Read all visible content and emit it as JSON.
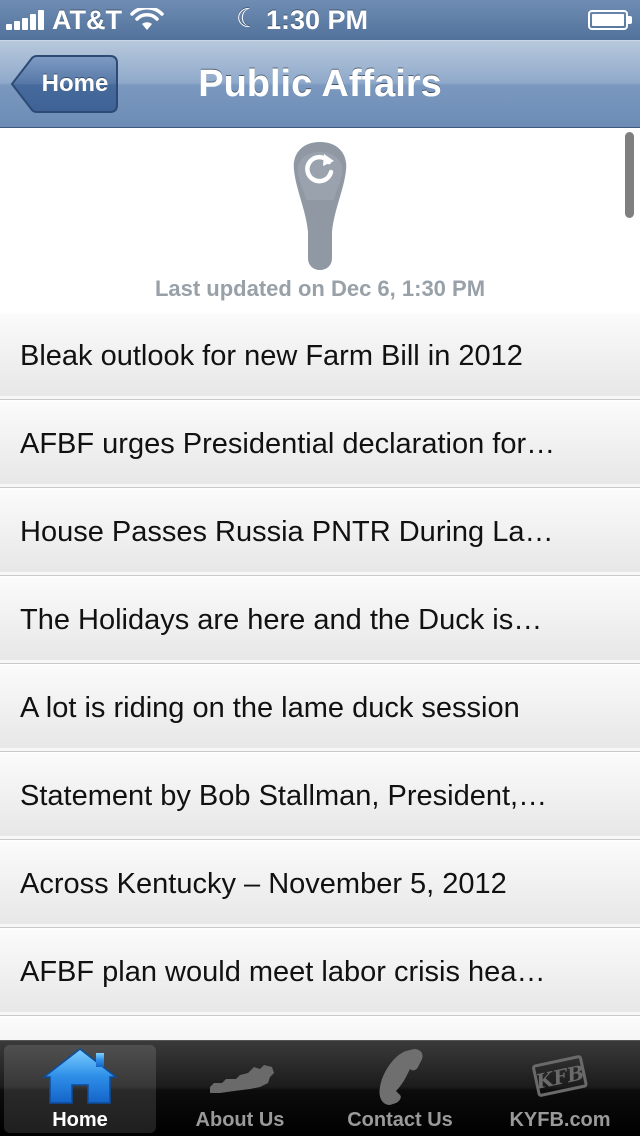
{
  "status_bar": {
    "carrier": "AT&T",
    "time": "1:30 PM",
    "battery_level": 1.0,
    "icons": [
      "signal-icon",
      "wifi-icon",
      "moon-icon",
      "battery-icon"
    ]
  },
  "nav_bar": {
    "back_label": "Home",
    "title": "Public Affairs"
  },
  "refresh": {
    "last_updated": "Last updated on Dec 6, 1:30 PM",
    "icon": "refresh-icon"
  },
  "articles": [
    {
      "title": "Bleak outlook for new Farm Bill in 2012"
    },
    {
      "title": "AFBF urges Presidential declaration for…"
    },
    {
      "title": "House Passes Russia PNTR During La…"
    },
    {
      "title": "The Holidays are here and the Duck is…"
    },
    {
      "title": "A lot is riding on the lame duck session"
    },
    {
      "title": "Statement by Bob Stallman, President,…"
    },
    {
      "title": "Across Kentucky – November 5, 2012"
    },
    {
      "title": "AFBF plan would meet labor crisis hea…"
    },
    {
      "title": ""
    }
  ],
  "tab_bar": {
    "tabs": [
      {
        "label": "Home",
        "icon": "house-icon",
        "selected": true
      },
      {
        "label": "About Us",
        "icon": "kentucky-map-icon",
        "selected": false
      },
      {
        "label": "Contact Us",
        "icon": "phone-icon",
        "selected": false
      },
      {
        "label": "KYFB.com",
        "icon": "kfb-logo-icon",
        "selected": false,
        "logo_text": "KFB"
      }
    ]
  },
  "colors": {
    "nav_bar": "#7a98bf",
    "status_bar": "#5f7fa8",
    "refresh_text": "#98a0a8",
    "selected_tab_icon": "#2f8fe8"
  }
}
